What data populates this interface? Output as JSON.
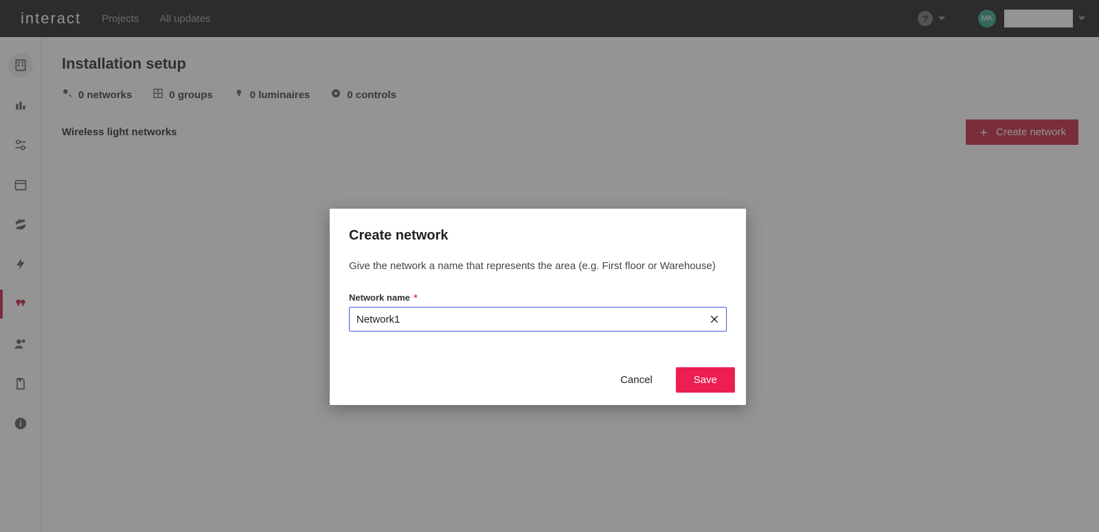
{
  "brand": "interact",
  "topnav": {
    "projects": "Projects",
    "updates": "All updates"
  },
  "help_glyph": "?",
  "avatar_initials": "MK",
  "page": {
    "title": "Installation setup",
    "stats": {
      "networks": "0 networks",
      "groups": "0 groups",
      "luminaires": "0 luminaires",
      "controls": "0 controls"
    },
    "section_title": "Wireless light networks",
    "create_button": "Create network"
  },
  "modal": {
    "title": "Create network",
    "description": "Give the network a name that represents the area (e.g. First floor or Warehouse)",
    "field_label": "Network name",
    "required_mark": "*",
    "input_value": "Network1",
    "cancel": "Cancel",
    "save": "Save"
  }
}
